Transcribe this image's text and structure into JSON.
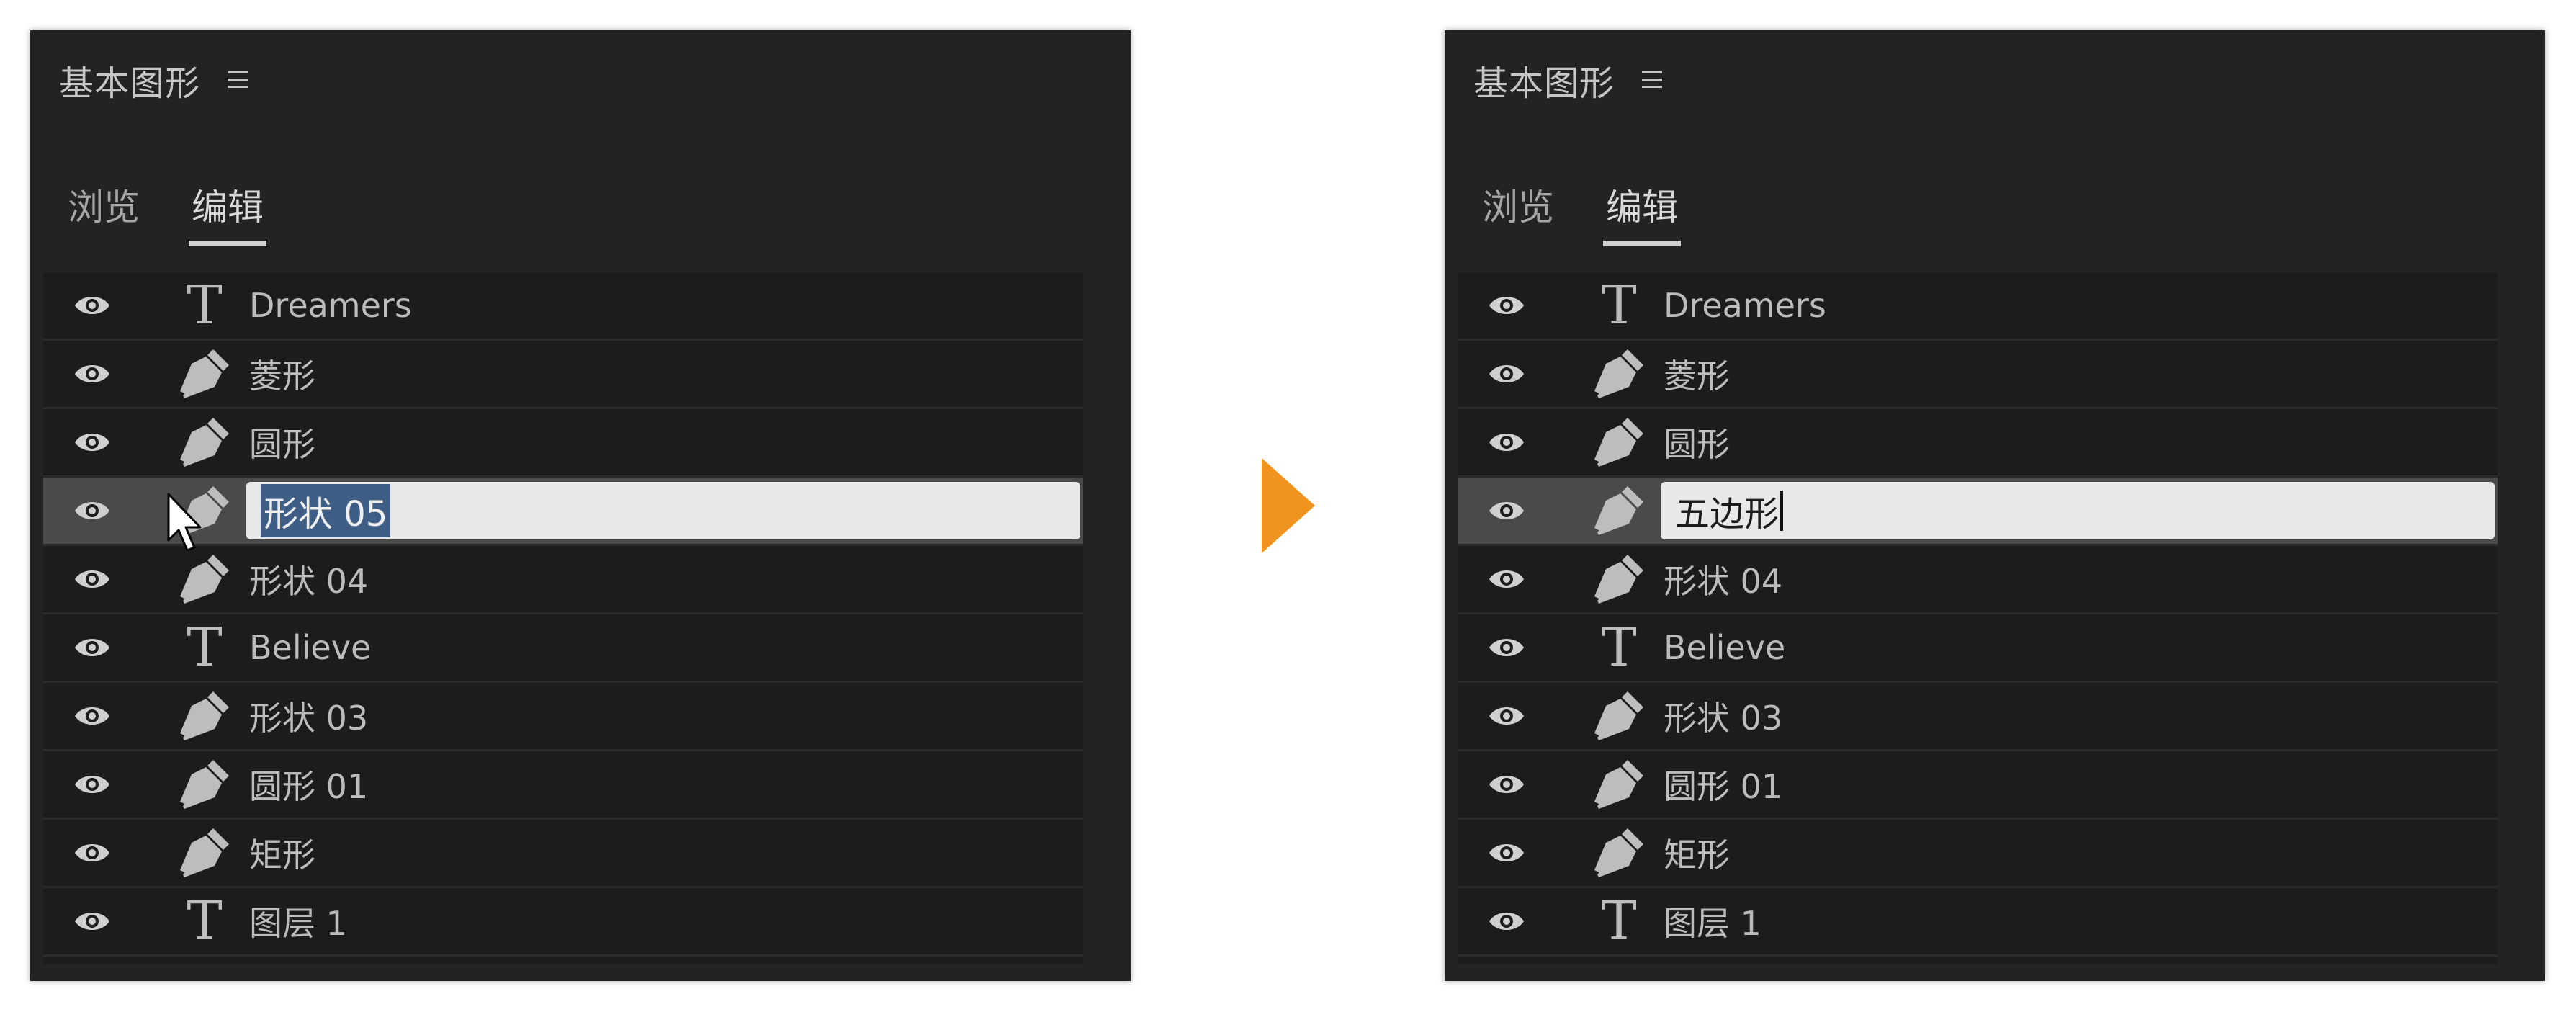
{
  "before": {
    "panel_title": "基本图形",
    "tabs": [
      {
        "label": "浏览"
      },
      {
        "label": "编辑"
      }
    ],
    "active_tab": "编辑",
    "layers": [
      {
        "icon": "text-layer-icon",
        "name": "Dreamers"
      },
      {
        "icon": "pen-shape-icon",
        "name": "菱形"
      },
      {
        "icon": "pen-shape-icon",
        "name": "圆形"
      },
      {
        "icon": "pen-shape-icon",
        "name": "形状 05",
        "editing": true,
        "selected_text": "形状 05"
      },
      {
        "icon": "pen-shape-icon",
        "name": "形状 04"
      },
      {
        "icon": "text-layer-icon",
        "name": "Believe"
      },
      {
        "icon": "pen-shape-icon",
        "name": "形状 03"
      },
      {
        "icon": "pen-shape-icon",
        "name": "圆形 01"
      },
      {
        "icon": "pen-shape-icon",
        "name": "矩形"
      },
      {
        "icon": "text-layer-icon",
        "name": "图层 1"
      }
    ]
  },
  "after": {
    "panel_title": "基本图形",
    "tabs": [
      {
        "label": "浏览"
      },
      {
        "label": "编辑"
      }
    ],
    "active_tab": "编辑",
    "layers": [
      {
        "icon": "text-layer-icon",
        "name": "Dreamers"
      },
      {
        "icon": "pen-shape-icon",
        "name": "菱形"
      },
      {
        "icon": "pen-shape-icon",
        "name": "圆形"
      },
      {
        "icon": "pen-shape-icon",
        "name": "五边形",
        "editing": true
      },
      {
        "icon": "pen-shape-icon",
        "name": "形状 04"
      },
      {
        "icon": "text-layer-icon",
        "name": "Believe"
      },
      {
        "icon": "pen-shape-icon",
        "name": "形状 03"
      },
      {
        "icon": "pen-shape-icon",
        "name": "圆形 01"
      },
      {
        "icon": "pen-shape-icon",
        "name": "矩形"
      },
      {
        "icon": "text-layer-icon",
        "name": "图层 1"
      }
    ]
  },
  "colors": {
    "panel_bg": "#232323",
    "list_bg": "#1c1c1c",
    "selected_row": "#4a4a4a",
    "text_selection": "#3f5e86",
    "arrow_accent": "#f0941f"
  }
}
